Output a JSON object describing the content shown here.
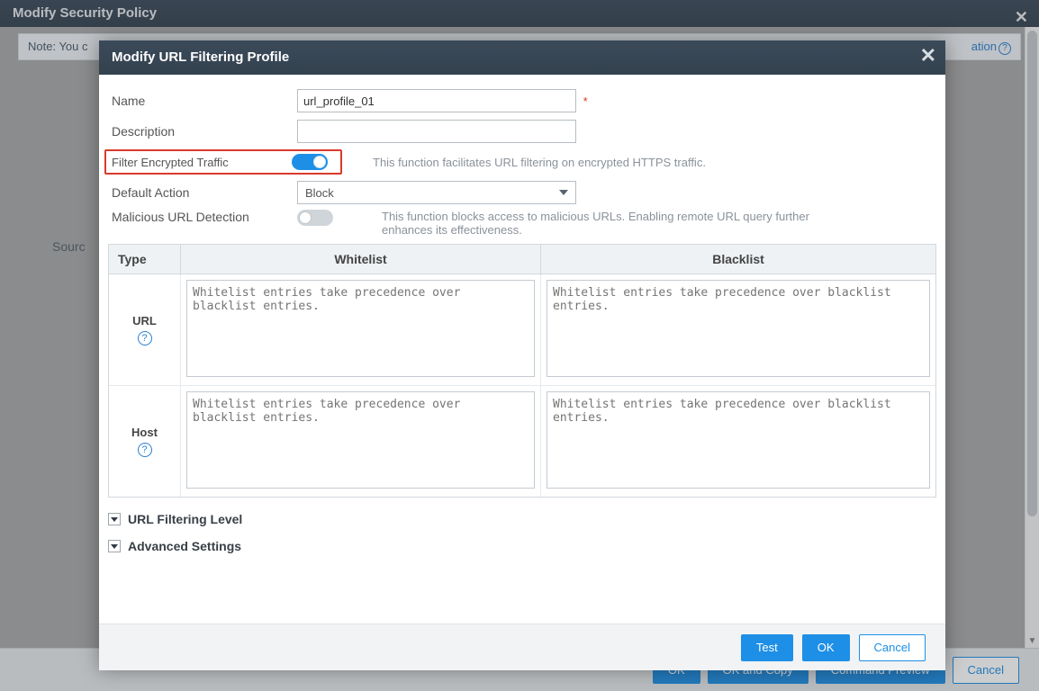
{
  "outer": {
    "title": "Modify Security Policy",
    "note_prefix": "Note: You c",
    "note_link": "ation",
    "sourc_label": "Sourc",
    "buttons": {
      "ok": "OK",
      "ok_copy": "OK and Copy",
      "preview": "Command Preview",
      "cancel": "Cancel"
    }
  },
  "modal": {
    "title": "Modify URL Filtering Profile",
    "labels": {
      "name": "Name",
      "description": "Description",
      "filter_enc": "Filter Encrypted Traffic",
      "default_action": "Default Action",
      "malicious": "Malicious URL Detection"
    },
    "values": {
      "name": "url_profile_01",
      "description": "",
      "default_action": "Block"
    },
    "hints": {
      "filter_enc": "This function facilitates URL filtering on encrypted HTTPS traffic.",
      "malicious": "This function blocks access to malicious URLs. Enabling remote URL query further enhances its effectiveness."
    },
    "toggles": {
      "filter_enc": true,
      "malicious": false
    },
    "table": {
      "headers": {
        "type": "Type",
        "whitelist": "Whitelist",
        "blacklist": "Blacklist"
      },
      "rows": [
        {
          "type": "URL",
          "wl_placeholder": "Whitelist entries take precedence over blacklist entries.",
          "bl_placeholder": "Whitelist entries take precedence over blacklist entries."
        },
        {
          "type": "Host",
          "wl_placeholder": "Whitelist entries take precedence over blacklist entries.",
          "bl_placeholder": "Whitelist entries take precedence over blacklist entries."
        }
      ]
    },
    "accordion": {
      "url_level": "URL Filtering Level",
      "advanced": "Advanced Settings"
    },
    "buttons": {
      "test": "Test",
      "ok": "OK",
      "cancel": "Cancel"
    }
  }
}
